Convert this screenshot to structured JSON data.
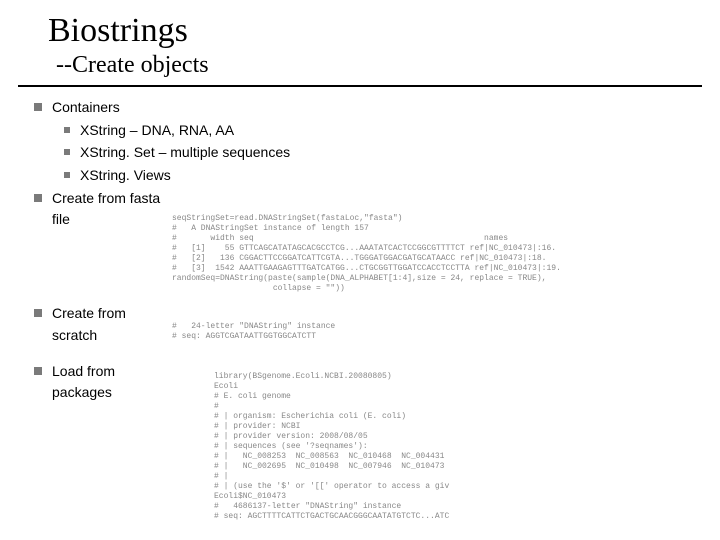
{
  "title": "Biostrings",
  "subtitle_prefix": "--",
  "subtitle_text": "Create objects",
  "bullets": {
    "containers": {
      "label": "Containers",
      "sub": [
        "XString – DNA, RNA, AA",
        "XString. Set – multiple sequences",
        "XString. Views"
      ]
    },
    "create_from_fasta": "Create from fasta file",
    "create_from_scratch": "Create from scratch",
    "load_from_packages": "Load from packages"
  },
  "code": {
    "fasta": "seqStringSet=read.DNAStringSet(fastaLoc,\"fasta\")\n#   A DNAStringSet instance of length 157\n#       width seq                                                names\n#   [1]    55 GTTCAGCATATAGCACGCCTCG...AAATATCACTCCGGCGTTTTCT ref|NC_010473|:16.\n#   [2]   136 CGGACTTCCGGATCATTCGTA...TGGGATGGACGATGCATAACC ref|NC_010473|:18.\n#   [3]  1542 AAATTGAAGAGTTTGATCATGG...CTGCGGTTGGATCCACCTCCTTA ref|NC_010473|:19.\nrandomSeq=DNAString(paste(sample(DNA_ALPHABET[1:4],size = 24, replace = TRUE),\n                     collapse = \"\"))",
    "scratch": "#   24-letter \"DNAString\" instance\n# seq: AGGTCGATAATTGGTGGCATCTT",
    "packages": "library(BSgenome.Ecoli.NCBI.20080805)\nEcoli\n# E. coli genome\n#\n# | organism: Escherichia coli (E. coli)\n# | provider: NCBI\n# | provider version: 2008/08/05\n# | sequences (see '?seqnames'):\n# |   NC_008253  NC_008563  NC_010468  NC_004431\n# |   NC_002695  NC_010498  NC_007946  NC_010473\n# |\n# | (use the '$' or '[[' operator to access a giv\nEcoli$NC_010473\n#   4686137-letter \"DNAString\" instance\n# seq: AGCTTTTCATTCTGACTGCAACGGGCAATATGTCTC...ATC"
  }
}
